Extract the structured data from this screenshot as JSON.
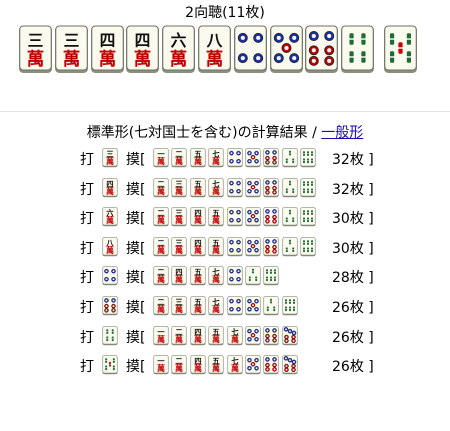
{
  "hand": {
    "title": "2向聴(11枚)",
    "tiles": [
      "3m",
      "3m",
      "4m",
      "4m",
      "6m",
      "8m",
      "4p",
      "5p",
      "6p",
      "4s",
      "5s"
    ]
  },
  "calc": {
    "prefix": "標準形(七対国士を含む)の計算結果 / ",
    "link_label": "一般形"
  },
  "labels": {
    "discard": "打",
    "draw_open": "摸[",
    "close": "]"
  },
  "rows": [
    {
      "discard": "3m",
      "waits": [
        "1m",
        "2m",
        "5m",
        "7m",
        "4p",
        "5p",
        "6p",
        "3s",
        "6s"
      ],
      "count": "32枚"
    },
    {
      "discard": "4m",
      "waits": [
        "2m",
        "3m",
        "5m",
        "7m",
        "4p",
        "5p",
        "6p",
        "3s",
        "6s"
      ],
      "count": "32枚"
    },
    {
      "discard": "6m",
      "waits": [
        "2m",
        "3m",
        "4m",
        "5m",
        "4p",
        "5p",
        "6p",
        "3s",
        "6s"
      ],
      "count": "30枚"
    },
    {
      "discard": "8m",
      "waits": [
        "2m",
        "3m",
        "4m",
        "5m",
        "4p",
        "5p",
        "6p",
        "3s",
        "6s"
      ],
      "count": "30枚"
    },
    {
      "discard": "4p",
      "waits": [
        "2m",
        "4m",
        "5m",
        "7m",
        "4p",
        "3s",
        "6s"
      ],
      "count": "28枚"
    },
    {
      "discard": "6p",
      "waits": [
        "2m",
        "3m",
        "5m",
        "7m",
        "4p",
        "5p",
        "3s",
        "6s"
      ],
      "count": "26枚"
    },
    {
      "discard": "4s",
      "waits": [
        "1m",
        "2m",
        "4m",
        "5m",
        "7m",
        "5p",
        "6p",
        "7p"
      ],
      "count": "26枚"
    },
    {
      "discard": "5s",
      "waits": [
        "1m",
        "2m",
        "4m",
        "5m",
        "7m",
        "5p",
        "6p",
        "7p"
      ],
      "count": "26枚"
    }
  ],
  "tile_colors": {
    "face": "#fbfaee",
    "side": "#8a8f7e",
    "man_red": "#c00000",
    "pin_blue": "#1b2fa8",
    "pin_red": "#c00000",
    "sou_green": "#1f6b34"
  }
}
